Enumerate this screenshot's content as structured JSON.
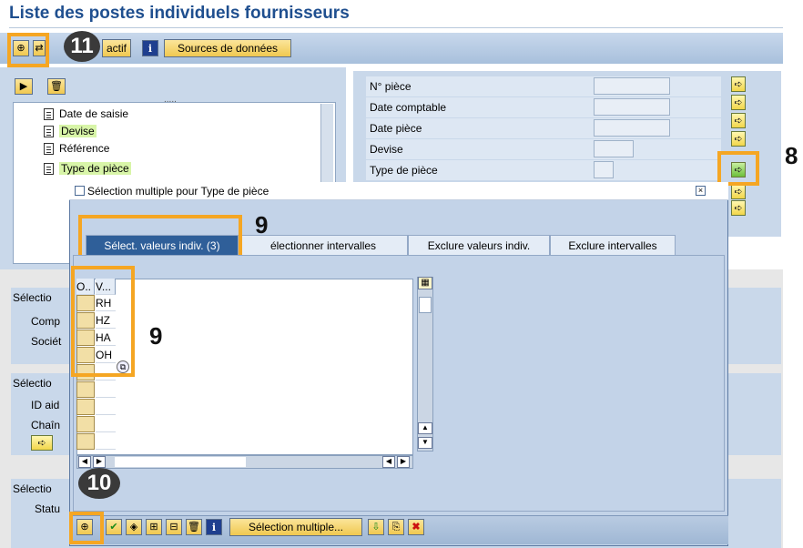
{
  "page_title": "Liste des postes individuels fournisseurs",
  "toolbar": {
    "actif_label": "actif",
    "sources_label": "Sources de données",
    "info_label": "i"
  },
  "tree": {
    "items": [
      {
        "label": "Date de saisie",
        "highlight": false
      },
      {
        "label": "Devise",
        "highlight": true
      },
      {
        "label": "Référence",
        "highlight": false
      },
      {
        "label": "Type de pièce",
        "highlight": true
      }
    ]
  },
  "fields": [
    {
      "label": "N° pièce"
    },
    {
      "label": "Date comptable"
    },
    {
      "label": "Date pièce"
    },
    {
      "label": "Devise"
    },
    {
      "label": "Type de pièce"
    }
  ],
  "left_sections": {
    "s1": "Sélectio",
    "comp": "Comp",
    "societe": "Sociét",
    "s2": "Sélectio",
    "id_aid": "ID aid",
    "chain": "Chaîn",
    "s3": "Sélectio",
    "statu": "Statu"
  },
  "dialog": {
    "title": "Sélection multiple pour Type de pièce",
    "tabs": [
      {
        "label": "Sélect. valeurs indiv. (3)",
        "active": true
      },
      {
        "label": "électionner intervalles",
        "active": false
      },
      {
        "label": "Exclure valeurs indiv.",
        "active": false
      },
      {
        "label": "Exclure intervalles",
        "active": false
      }
    ],
    "grid": {
      "col_o": "O..",
      "col_v": "V...",
      "rows": [
        "RH",
        "HZ",
        "HA",
        "OH",
        "",
        "",
        "",
        "",
        ""
      ]
    },
    "bottom_button": "Sélection multiple..."
  },
  "annotations": {
    "b11": "11",
    "b8": "8",
    "b9a": "9",
    "b9b": "9",
    "b10": "10"
  },
  "colors": {
    "title": "#1f4f8f",
    "marker": "#f5a623",
    "tab_active": "#2f5f99"
  }
}
